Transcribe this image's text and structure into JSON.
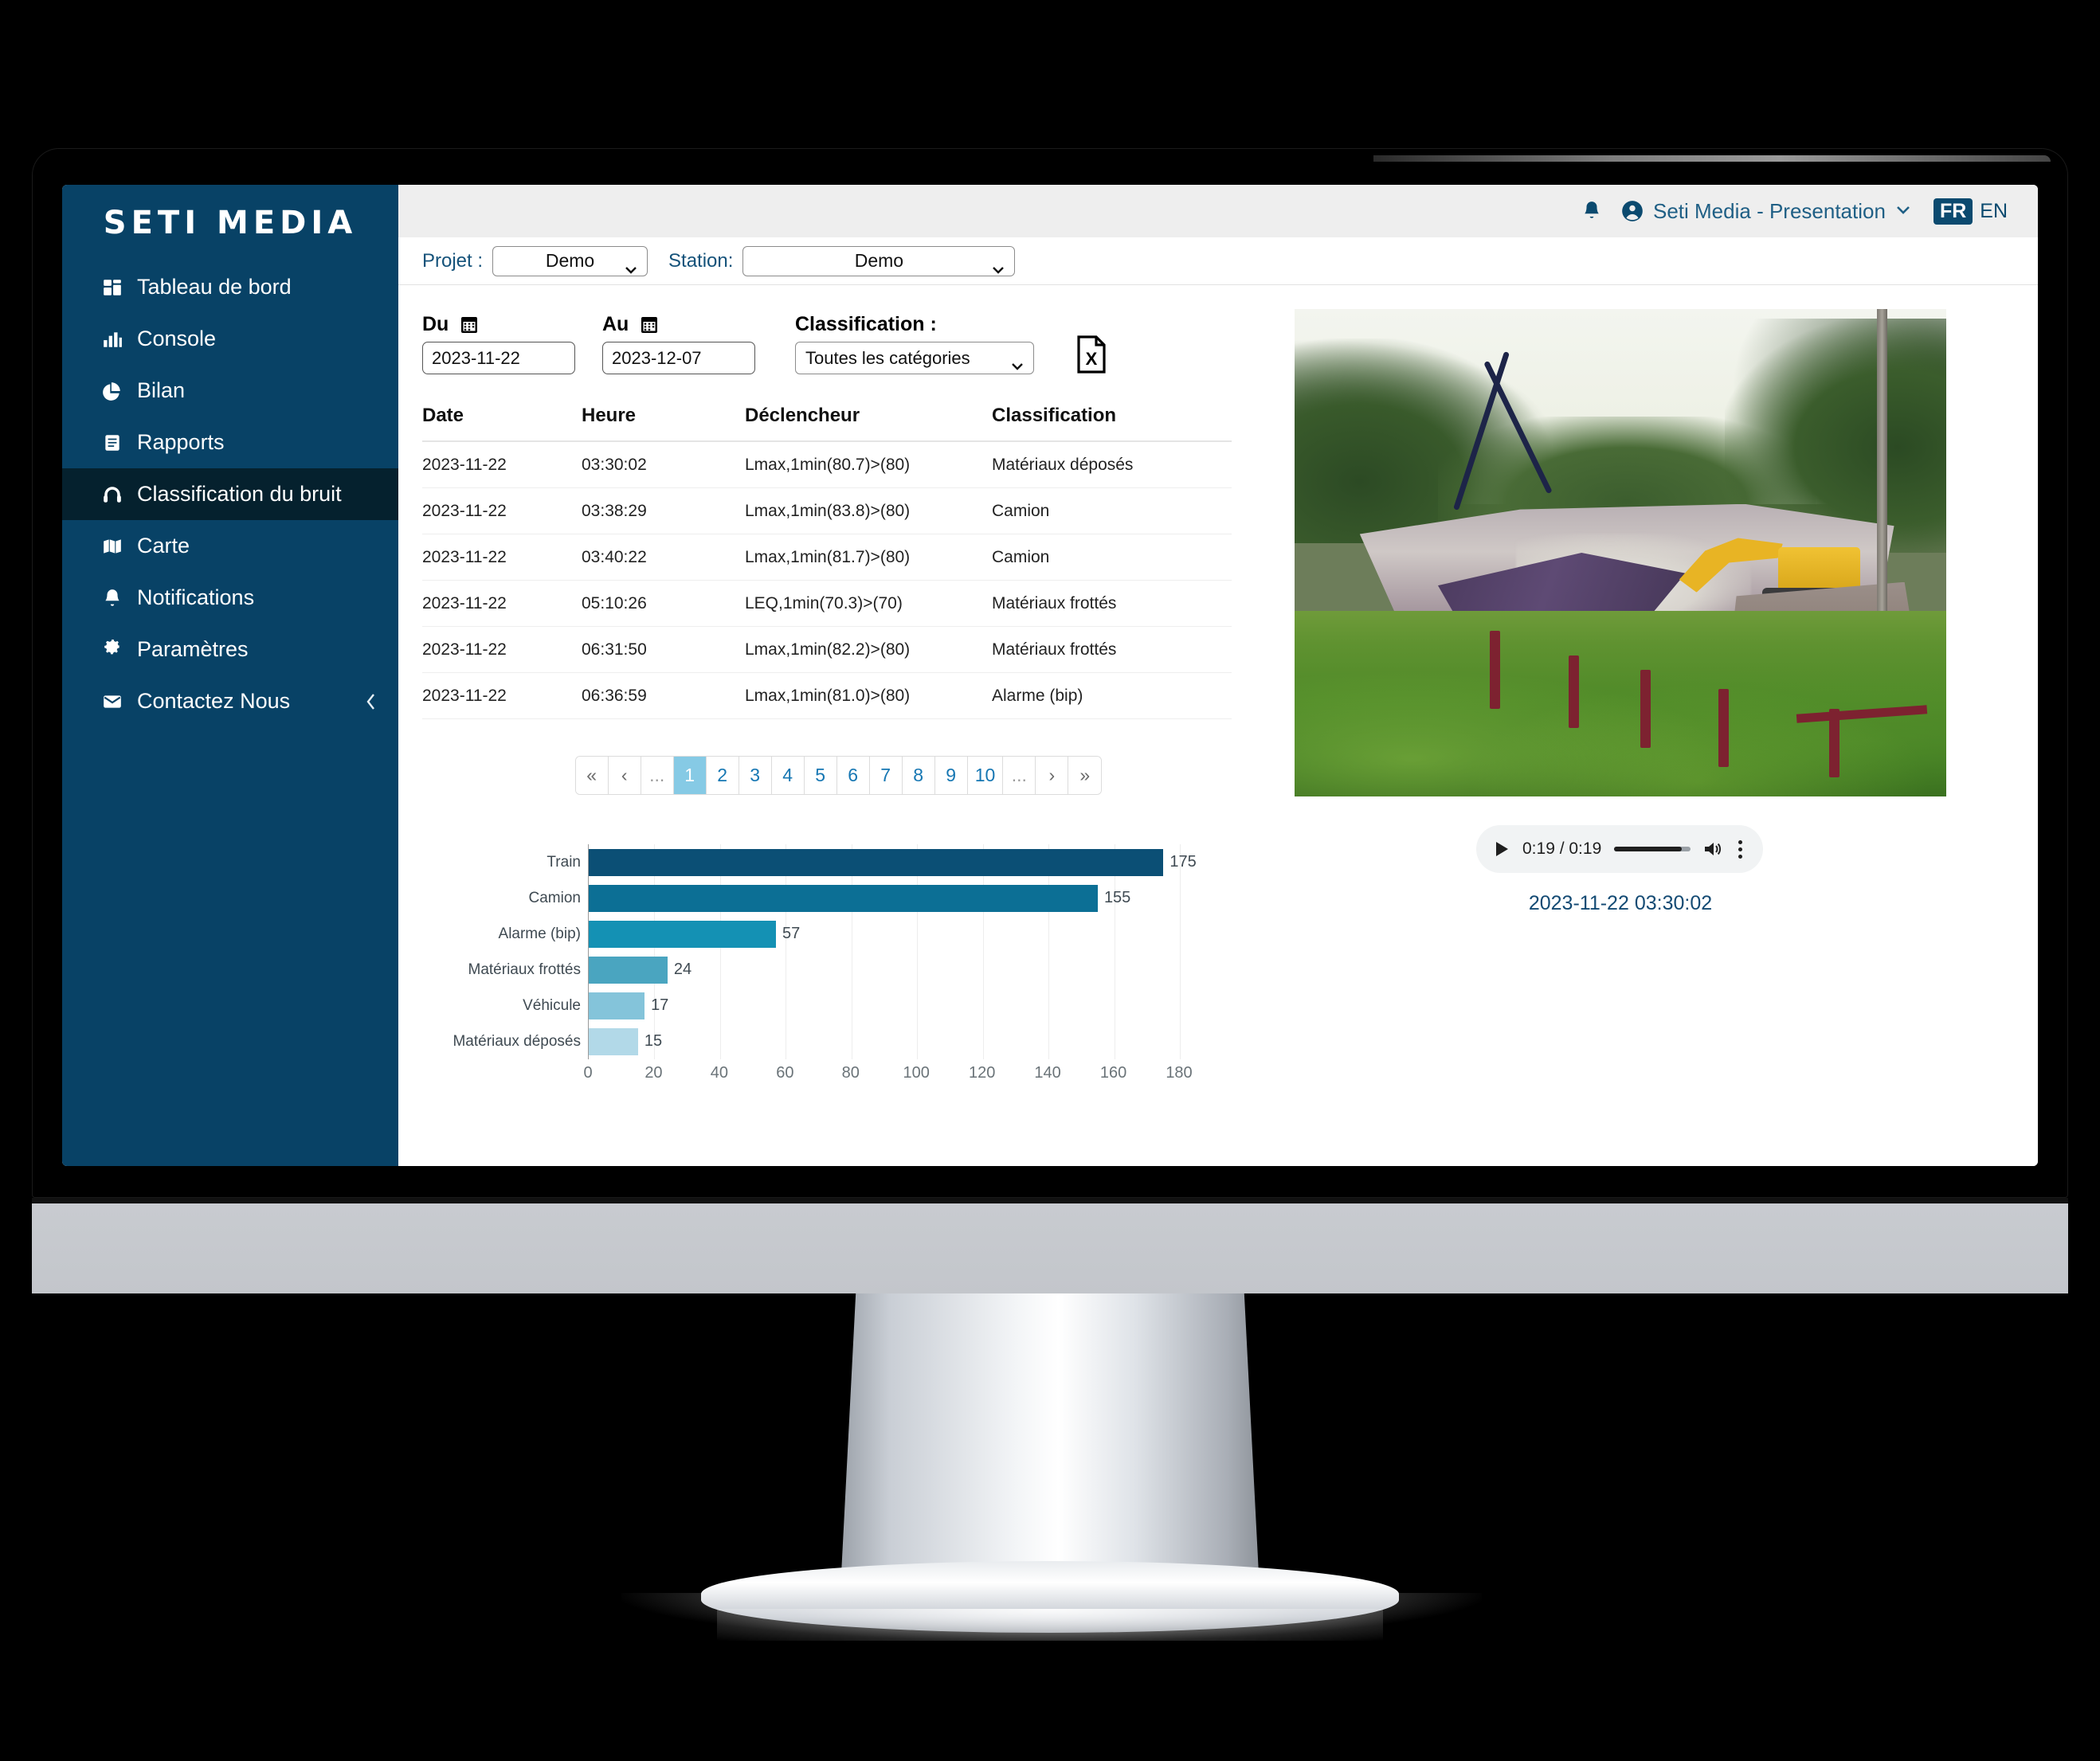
{
  "sidebar": {
    "brand": "SETI MEDIA",
    "items": [
      {
        "label": "Tableau de bord",
        "icon": "dashboard-icon",
        "active": false
      },
      {
        "label": "Console",
        "icon": "chart-bar-icon",
        "active": false
      },
      {
        "label": "Bilan",
        "icon": "pie-chart-icon",
        "active": false
      },
      {
        "label": "Rapports",
        "icon": "document-icon",
        "active": false
      },
      {
        "label": "Classification du bruit",
        "icon": "headphones-icon",
        "active": true
      },
      {
        "label": "Carte",
        "icon": "map-icon",
        "active": false
      },
      {
        "label": "Notifications",
        "icon": "bell-icon",
        "active": false
      },
      {
        "label": "Paramètres",
        "icon": "gear-icon",
        "active": false
      },
      {
        "label": "Contactez Nous",
        "icon": "envelope-icon",
        "active": false
      }
    ],
    "collapse_icon": "chevron-left-icon"
  },
  "topbar": {
    "bell_icon": "bell-icon",
    "user_icon": "user-circle-icon",
    "account_name": "Seti Media - Presentation",
    "caret_icon": "chevron-down-icon",
    "lang_active": "FR",
    "lang_other": "EN",
    "accent_color": "#0b4a6f"
  },
  "projectbar": {
    "projet_label": "Projet :",
    "projet_value": "Demo",
    "station_label": "Station:",
    "station_value": "Demo"
  },
  "filters": {
    "du_label": "Du",
    "du_value": "2023-11-22",
    "au_label": "Au",
    "au_value": "2023-12-07",
    "classification_label": "Classification :",
    "classification_value": "Toutes les catégories",
    "calendar_icon": "calendar-icon",
    "export_icon": "excel-file-icon"
  },
  "table": {
    "headers": [
      "Date",
      "Heure",
      "Déclencheur",
      "Classification"
    ],
    "rows": [
      {
        "date": "2023-11-22",
        "heure": "03:30:02",
        "declencheur": "Lmax,1min(80.7)>(80)",
        "classification": "Matériaux déposés"
      },
      {
        "date": "2023-11-22",
        "heure": "03:38:29",
        "declencheur": "Lmax,1min(83.8)>(80)",
        "classification": "Camion"
      },
      {
        "date": "2023-11-22",
        "heure": "03:40:22",
        "declencheur": "Lmax,1min(81.7)>(80)",
        "classification": "Camion"
      },
      {
        "date": "2023-11-22",
        "heure": "05:10:26",
        "declencheur": "LEQ,1min(70.3)>(70)",
        "classification": "Matériaux frottés"
      },
      {
        "date": "2023-11-22",
        "heure": "06:31:50",
        "declencheur": "Lmax,1min(82.2)>(80)",
        "classification": "Matériaux frottés"
      },
      {
        "date": "2023-11-22",
        "heure": "06:36:59",
        "declencheur": "Lmax,1min(81.0)>(80)",
        "classification": "Alarme (bip)"
      }
    ]
  },
  "pagination": {
    "first": "«",
    "prev": "‹",
    "dots_left": "...",
    "pages": [
      "1",
      "2",
      "3",
      "4",
      "5",
      "6",
      "7",
      "8",
      "9",
      "10"
    ],
    "dots_right": "...",
    "next": "›",
    "last": "»",
    "active_page": "1",
    "active_color": "#86cae5"
  },
  "chart_data": {
    "type": "bar",
    "orientation": "horizontal",
    "title": "",
    "xlabel": "",
    "ylabel": "",
    "categories": [
      "Train",
      "Camion",
      "Alarme (bip)",
      "Matériaux frottés",
      "Véhicule",
      "Matériaux déposés"
    ],
    "values": [
      175,
      155,
      57,
      24,
      17,
      15
    ],
    "colors": [
      "#0b4f75",
      "#0c6f95",
      "#1491b4",
      "#4aa5c0",
      "#84c4da",
      "#b2d9e8"
    ],
    "xlim": [
      0,
      180
    ],
    "xticks": [
      0,
      20,
      40,
      60,
      80,
      100,
      120,
      140,
      160,
      180
    ],
    "grid": true,
    "legend": false,
    "data_labels": [
      "175",
      "155",
      "57",
      "24",
      "17",
      "15"
    ]
  },
  "media": {
    "scene_alt": "construction-site-photo",
    "player": {
      "play_icon": "play-icon",
      "time": "0:19 / 0:19",
      "volume_icon": "volume-icon",
      "menu_icon": "kebab-menu-icon",
      "progress_percent": 88
    },
    "timestamp": "2023-11-22 03:30:02"
  }
}
